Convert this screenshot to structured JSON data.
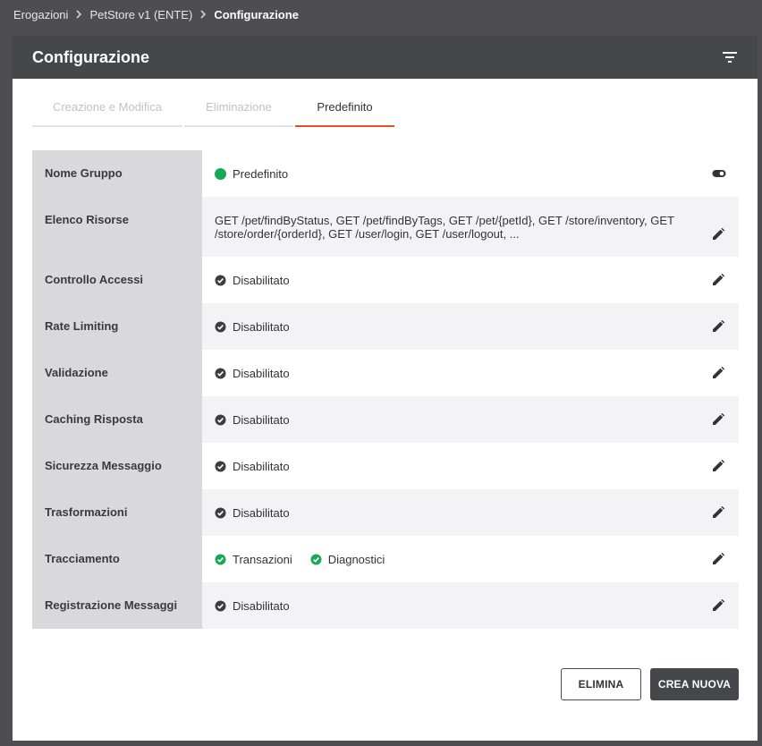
{
  "breadcrumb": {
    "items": [
      "Erogazioni",
      "PetStore v1 (ENTE)",
      "Configurazione"
    ]
  },
  "card": {
    "title": "Configurazione"
  },
  "tabs": [
    {
      "label": "Creazione e Modifica"
    },
    {
      "label": "Eliminazione"
    },
    {
      "label": "Predefinito"
    }
  ],
  "rows": [
    {
      "label": "Nome Gruppo",
      "value": "Predefinito",
      "icon": "green-dot",
      "action_icon": "toggle-icon"
    },
    {
      "label": "Elenco Risorse",
      "value": "GET /pet/findByStatus, GET /pet/findByTags, GET /pet/{petId}, GET /store/inventory, GET /store/order/{orderId}, GET /user/login, GET /user/logout, ...",
      "action_icon": "edit-icon"
    },
    {
      "label": "Controllo Accessi",
      "value": "Disabilitato",
      "icon": "check-circle-dark",
      "action_icon": "edit-icon"
    },
    {
      "label": "Rate Limiting",
      "value": "Disabilitato",
      "icon": "check-circle-dark",
      "action_icon": "edit-icon"
    },
    {
      "label": "Validazione",
      "value": "Disabilitato",
      "icon": "check-circle-dark",
      "action_icon": "edit-icon"
    },
    {
      "label": "Caching Risposta",
      "value": "Disabilitato",
      "icon": "check-circle-dark",
      "action_icon": "edit-icon"
    },
    {
      "label": "Sicurezza Messaggio",
      "value": "Disabilitato",
      "icon": "check-circle-dark",
      "action_icon": "edit-icon"
    },
    {
      "label": "Trasformazioni",
      "value": "Disabilitato",
      "icon": "check-circle-dark",
      "action_icon": "edit-icon"
    },
    {
      "label": "Tracciamento",
      "values": [
        "Transazioni",
        "Diagnostici"
      ],
      "icon": "check-circle-green",
      "action_icon": "edit-icon"
    },
    {
      "label": "Registrazione Messaggi",
      "value": "Disabilitato",
      "icon": "check-circle-dark",
      "action_icon": "edit-icon"
    }
  ],
  "actions": {
    "delete_label": "ELIMINA",
    "create_label": "CREA NUOVA"
  },
  "colors": {
    "header_bg": "#46474b",
    "tab_active_underline": "#e0521e",
    "status_green": "#18a957",
    "status_dark": "#4a4a4a"
  }
}
